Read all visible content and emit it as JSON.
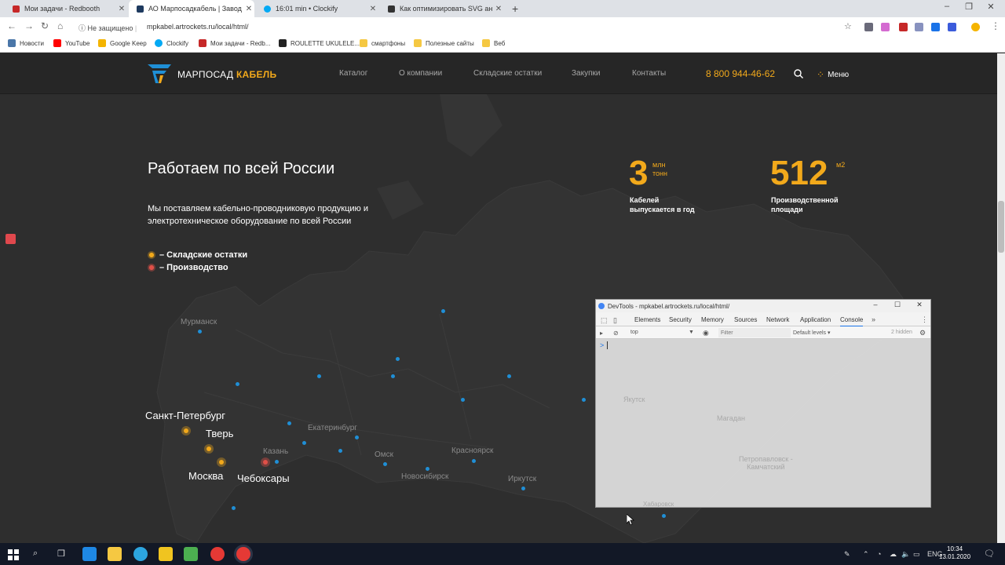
{
  "browser": {
    "tabs": [
      {
        "title": "Мои задачи - Redbooth",
        "color": "#c62828"
      },
      {
        "title": "АО Марпосадкабель | Завод пр",
        "color": "#1e3a5f"
      },
      {
        "title": "16:01 min • Clockify",
        "color": "#03a9f4"
      },
      {
        "title": "Как оптимизировать SVG анима",
        "color": "#333333"
      }
    ],
    "security_label": "Не защищено",
    "url": "mpkabel.artrockets.ru/local/html/",
    "bookmarks": [
      {
        "label": "Новости",
        "color": "#4a76a8"
      },
      {
        "label": "YouTube",
        "color": "#ff0000"
      },
      {
        "label": "Google Keep",
        "color": "#f4b400"
      },
      {
        "label": "Clockify",
        "color": "#03a9f4"
      },
      {
        "label": "Мои задачи - Redb...",
        "color": "#c62828"
      },
      {
        "label": "ROULETTE UKULELE...",
        "color": "#222222"
      },
      {
        "label": "смартфоны",
        "color": "#f5c842"
      },
      {
        "label": "Полезные сайты",
        "color": "#f5c842"
      },
      {
        "label": "Веб",
        "color": "#f5c842"
      }
    ]
  },
  "site": {
    "brand_main": "МАРПОСАД",
    "brand_accent": "КАБЕЛЬ",
    "nav": [
      "Каталог",
      "О компании",
      "Складские остатки",
      "Закупки",
      "Контакты"
    ],
    "phone": "8 800 944-46-62",
    "menu_label": "Меню",
    "heading": "Работаем по всей России",
    "description": "Мы поставляем кабельно-проводниковую продукцию и электротехническое оборудование по всей России",
    "legend": [
      {
        "label": "– Складские остатки",
        "color": "#f2a91b"
      },
      {
        "label": "– Производство",
        "color": "#e05048"
      }
    ],
    "stats": [
      {
        "value": "3",
        "unit_line1": "млн",
        "unit_line2": "тонн",
        "label_line1": "Кабелей",
        "label_line2": "выпускается в год"
      },
      {
        "value": "512",
        "unit_line1": "м2",
        "unit_line2": "",
        "label_line1": "Производственной",
        "label_line2": "площади"
      }
    ],
    "map_cities": {
      "murmansk": "Мурманск",
      "ekaterinburg": "Екатеринбург",
      "kazan": "Казань",
      "omsk": "Омск",
      "krasnoyarsk": "Красноярск",
      "novosibirsk": "Новосибирск",
      "irkutsk": "Иркутск",
      "spb": "Санкт-Петербург",
      "tver": "Тверь",
      "moscow": "Москва",
      "cheboksary": "Чебоксары"
    },
    "accent_color": "#f2a91b"
  },
  "devtools": {
    "title": "DevTools - mpkabel.artrockets.ru/local/html/",
    "tabs": [
      "Elements",
      "Security",
      "Memory",
      "Sources",
      "Network",
      "Application",
      "Console"
    ],
    "active_tab": "Console",
    "context": "top",
    "filter_placeholder": "Filter",
    "levels": "Default levels",
    "hidden": "2 hidden",
    "prompt": ">",
    "map_cities": {
      "yakutsk": "Якутск",
      "magadan": "Магадан",
      "petropavlovsk_1": "Петропавловск -",
      "petropavlovsk_2": "Камчатский",
      "khabarovsk": "Хабаровск"
    }
  },
  "taskbar": {
    "lang": "ENG",
    "time": "10:34",
    "date": "13.01.2020"
  }
}
